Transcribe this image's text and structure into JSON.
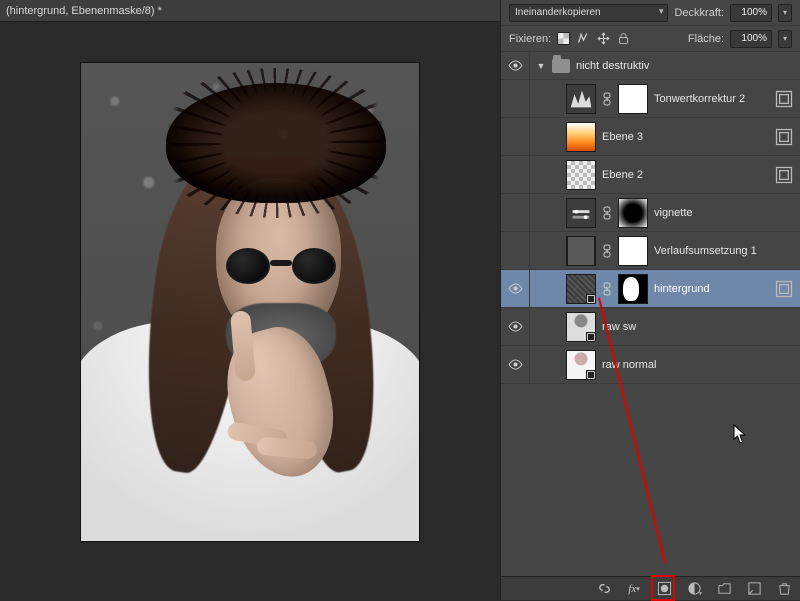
{
  "document": {
    "title": "(hintergrund, Ebenenmaske/8) *"
  },
  "panel": {
    "blendMode": "Ineinanderkopieren",
    "opacityLabel": "Deckkraft:",
    "opacityValue": "100%",
    "lockLabel": "Fixieren:",
    "fillLabel": "Fläche:",
    "fillValue": "100%"
  },
  "group": {
    "name": "nicht destruktiv"
  },
  "layers": [
    {
      "name": "Tonwertkorrektur 2",
      "visible": false,
      "adjIcon": "levels",
      "mask": "white",
      "smartBadge": false,
      "filterBadge": true
    },
    {
      "name": "Ebene 3",
      "visible": false,
      "adjIcon": null,
      "thumbClass": "grad-orange",
      "mask": null,
      "filterBadge": true
    },
    {
      "name": "Ebene 2",
      "visible": false,
      "adjIcon": null,
      "thumbClass": "checkerboard",
      "mask": null,
      "filterBadge": true
    },
    {
      "name": "vignette",
      "visible": false,
      "adjIcon": "exposure",
      "mask": "vignette",
      "filterBadge": false
    },
    {
      "name": "Verlaufsumsetzung 1",
      "visible": false,
      "adjIcon": "gray",
      "mask": "white",
      "filterBadge": false
    },
    {
      "name": "hintergrund",
      "visible": true,
      "adjIcon": null,
      "thumbClass": "texture-thumb",
      "mask": "shape",
      "smartBadge": true,
      "selected": true,
      "filterBadge": true
    },
    {
      "name": "raw sw",
      "visible": true,
      "adjIcon": null,
      "thumbClass": "photo-thumb-bw",
      "mask": null,
      "smartBadge": true
    },
    {
      "name": "raw normal",
      "visible": true,
      "adjIcon": null,
      "thumbClass": "photo-thumb",
      "mask": null,
      "smartBadge": true
    }
  ],
  "footerIcons": [
    "link",
    "fx",
    "mask",
    "adjust",
    "group",
    "new",
    "trash"
  ]
}
